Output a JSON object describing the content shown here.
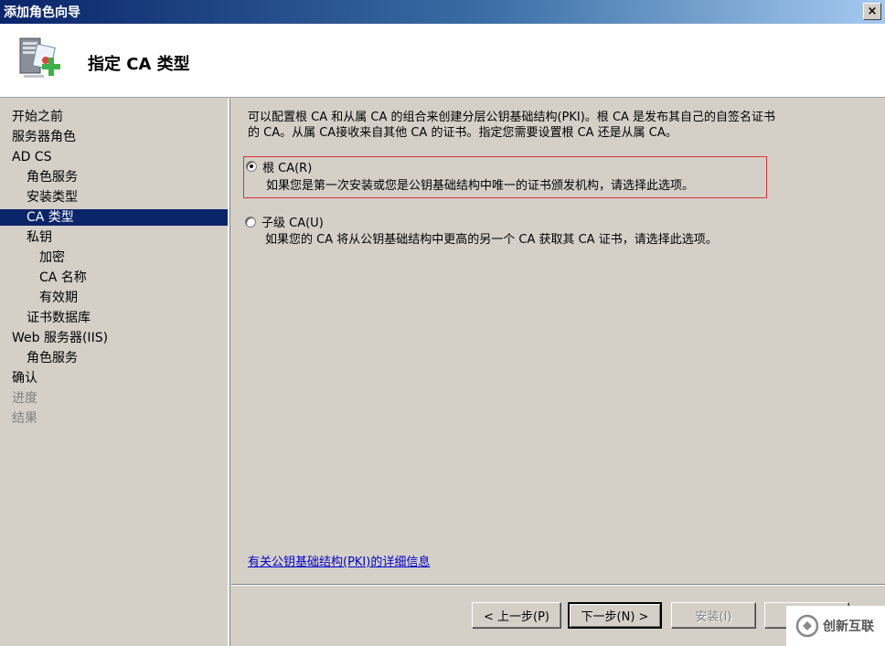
{
  "window": {
    "title": "添加角色向导",
    "close_glyph": "×"
  },
  "header": {
    "title": "指定 CA 类型",
    "icon": "server-certificate-add-icon"
  },
  "sidebar": {
    "items": [
      {
        "label": "开始之前",
        "level": 0,
        "state": "normal"
      },
      {
        "label": "服务器角色",
        "level": 0,
        "state": "normal"
      },
      {
        "label": "AD CS",
        "level": 0,
        "state": "normal"
      },
      {
        "label": "角色服务",
        "level": 1,
        "state": "normal"
      },
      {
        "label": "安装类型",
        "level": 1,
        "state": "normal"
      },
      {
        "label": "CA 类型",
        "level": 1,
        "state": "active"
      },
      {
        "label": "私钥",
        "level": 1,
        "state": "normal"
      },
      {
        "label": "加密",
        "level": 2,
        "state": "normal"
      },
      {
        "label": "CA 名称",
        "level": 2,
        "state": "normal"
      },
      {
        "label": "有效期",
        "level": 2,
        "state": "normal"
      },
      {
        "label": "证书数据库",
        "level": 1,
        "state": "normal"
      },
      {
        "label": "Web 服务器(IIS)",
        "level": 0,
        "state": "normal"
      },
      {
        "label": "角色服务",
        "level": 1,
        "state": "normal"
      },
      {
        "label": "确认",
        "level": 0,
        "state": "normal"
      },
      {
        "label": "进度",
        "level": 0,
        "state": "disabled"
      },
      {
        "label": "结果",
        "level": 0,
        "state": "disabled"
      }
    ]
  },
  "content": {
    "intro_line1": "可以配置根 CA 和从属 CA 的组合来创建分层公钥基础结构(PKI)。根 CA 是发布其自己的自签名证书",
    "intro_line2": "的 CA。从属 CA接收来自其他 CA 的证书。指定您需要设置根 CA 还是从属 CA。",
    "options": {
      "root": {
        "label": "根 CA(R)",
        "description": "如果您是第一次安装或您是公钥基础结构中唯一的证书颁发机构，请选择此选项。",
        "selected": true
      },
      "subordinate": {
        "label": "子级 CA(U)",
        "description": "如果您的 CA 将从公钥基础结构中更高的另一个 CA 获取其 CA 证书，请选择此选项。",
        "selected": false
      }
    },
    "info_link": "有关公钥基础结构(PKI)的详细信息"
  },
  "footer": {
    "back": "< 上一步(P)",
    "next": "下一步(N) >",
    "install": "安装(I)",
    "cancel": "取消"
  },
  "watermark": {
    "text": "创新互联"
  }
}
